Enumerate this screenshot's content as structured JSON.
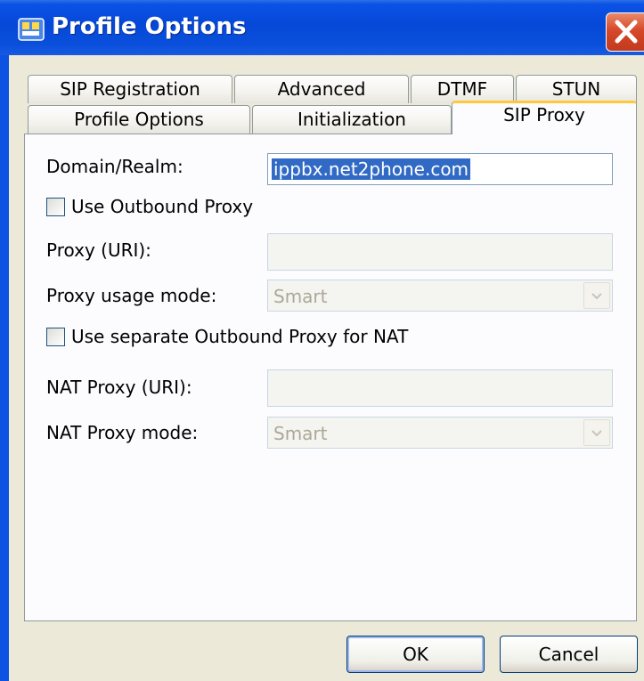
{
  "window": {
    "title": "Profile Options",
    "title_color": "#0a52e6",
    "close_color": "#d6482a"
  },
  "tabs": {
    "row1": [
      "SIP Registration",
      "Advanced",
      "DTMF",
      "STUN"
    ],
    "row2": [
      "Profile Options",
      "Initialization",
      "SIP Proxy"
    ],
    "active": "SIP Proxy",
    "active_accent": "#ffc83c"
  },
  "form": {
    "domain_label": "Domain/Realm:",
    "domain_value": "ippbx.net2phone.com",
    "use_outbound_label": "Use Outbound Proxy",
    "use_outbound_checked": false,
    "proxy_uri_label": "Proxy (URI):",
    "proxy_uri_value": "",
    "proxy_mode_label": "Proxy usage mode:",
    "proxy_mode_value": "Smart",
    "use_separate_nat_label": "Use separate Outbound Proxy for NAT",
    "use_separate_nat_checked": false,
    "nat_proxy_label": "NAT Proxy (URI):",
    "nat_proxy_value": "",
    "nat_mode_label": "NAT Proxy mode:",
    "nat_mode_value": "Smart"
  },
  "buttons": {
    "ok": "OK",
    "cancel": "Cancel"
  },
  "icons": {
    "app": "profile-app-icon",
    "close": "close-icon",
    "dropdown": "chevron-down-icon"
  }
}
